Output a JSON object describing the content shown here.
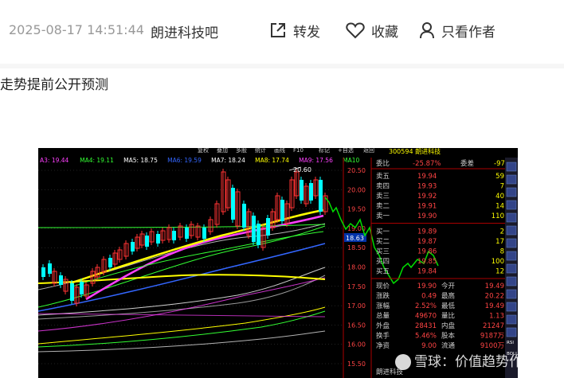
{
  "header": {
    "timestamp": "2025-08-17 14:51:44",
    "bar_name": "朗进科技吧",
    "share_label": "转发",
    "favorite_label": "收藏",
    "author_only_label": "只看作者"
  },
  "post": {
    "text": "走势提前公开预测"
  },
  "chart": {
    "menu": [
      "复权",
      "叠加",
      "多股",
      "统计",
      "画线",
      "F10",
      "标记",
      "+自选",
      "返回"
    ],
    "ma_legend": [
      {
        "label": "A3: 19.44",
        "color": "#ff40ff"
      },
      {
        "label": "MA4: 19.11",
        "color": "#33ff33"
      },
      {
        "label": "MA5: 18.75",
        "color": "#ffffff"
      },
      {
        "label": "MA6: 19.59",
        "color": "#3366ff"
      },
      {
        "label": "MA7: 18.24",
        "color": "#ffffff"
      },
      {
        "label": "MA8: 17.74",
        "color": "#ffff00"
      },
      {
        "label": "MA9: 17.56",
        "color": "#ff40ff"
      },
      {
        "label": "MA10",
        "color": "#33ff33"
      }
    ],
    "price_axis": [
      "20.50",
      "20.00",
      "19.50",
      "19.00",
      "18.50",
      "18.00",
      "17.50",
      "17.00",
      "16.50",
      "16.00",
      "15.50"
    ],
    "high_label": "20.60",
    "current_price_tag": "18.63",
    "stock_title": "300594 朗进科技",
    "wei_bi": {
      "label": "委比",
      "value": "-25.87%",
      "label2": "委差",
      "value2": "-97"
    },
    "sell_orders": [
      {
        "label": "卖五",
        "price": "19.94",
        "vol": "59"
      },
      {
        "label": "卖四",
        "price": "19.93",
        "vol": "7"
      },
      {
        "label": "卖三",
        "price": "19.92",
        "vol": "40"
      },
      {
        "label": "卖二",
        "price": "19.91",
        "vol": "14"
      },
      {
        "label": "卖一",
        "price": "19.90",
        "vol": "110"
      }
    ],
    "buy_orders": [
      {
        "label": "买一",
        "price": "19.89",
        "vol": "2"
      },
      {
        "label": "买二",
        "price": "19.87",
        "vol": "17"
      },
      {
        "label": "买三",
        "price": "19.86",
        "vol": "8"
      },
      {
        "label": "买四",
        "price": "19.85",
        "vol": "100"
      },
      {
        "label": "买五",
        "price": "19.84",
        "vol": "12"
      }
    ],
    "stats": [
      {
        "l1": "现价",
        "v1": "19.90",
        "l2": "今开",
        "v2": "19.49"
      },
      {
        "l1": "涨跌",
        "v1": "0.49",
        "l2": "最高",
        "v2": "20.22"
      },
      {
        "l1": "涨幅",
        "v1": "2.52%",
        "l2": "最低",
        "v2": "19.49"
      },
      {
        "l1": "总量",
        "v1": "49670",
        "l2": "量比",
        "v2": "1.13"
      },
      {
        "l1": "外盘",
        "v1": "28431",
        "l2": "内盘",
        "v2": "21247"
      },
      {
        "l1": "换手",
        "v1": "5.46%",
        "l2": "股本",
        "v2": "9187万"
      },
      {
        "l1": "净资",
        "v1": "9.00",
        "l2": "流通",
        "v2": "9100万"
      }
    ],
    "bottom_name": "朗进科技",
    "side_tools": [
      "RSI",
      "BOLL"
    ],
    "colors": {
      "up": "#ff3333",
      "down": "#00ffff",
      "accent": "#ffff00",
      "panel_text": "#ffffff"
    }
  },
  "watermark": {
    "text": "雪球：价值趋势作手"
  }
}
